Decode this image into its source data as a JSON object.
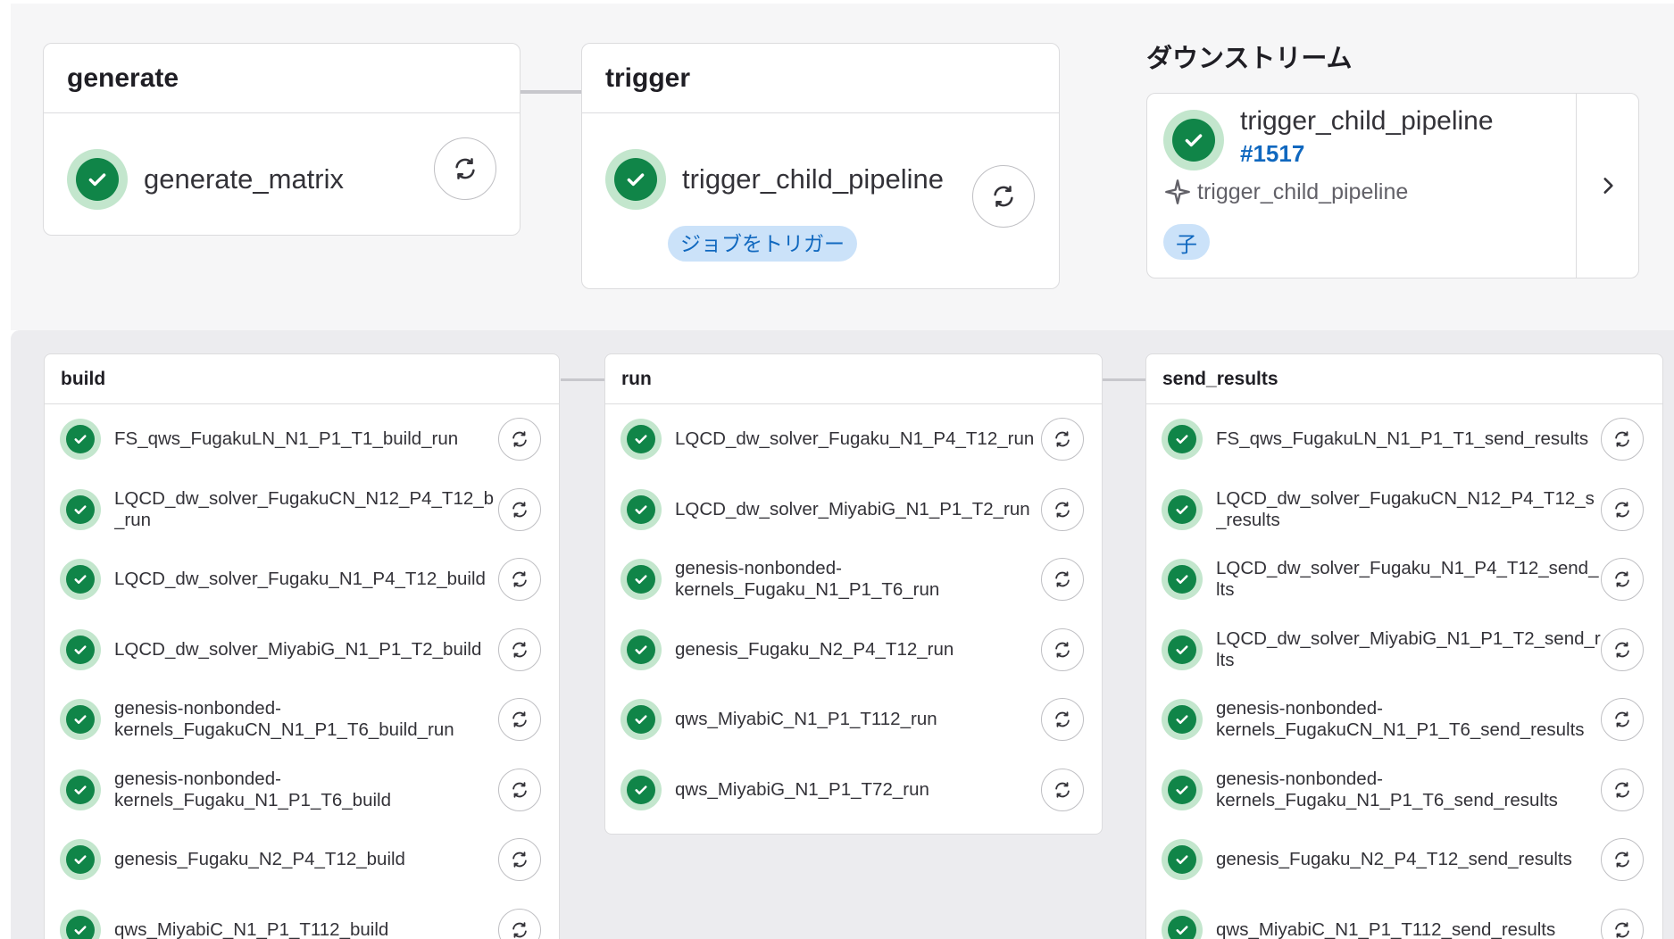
{
  "parent_pipeline": {
    "stages": [
      {
        "name": "generate",
        "job": {
          "name": "generate_matrix",
          "status": "success"
        }
      },
      {
        "name": "trigger",
        "job": {
          "name": "trigger_child_pipeline",
          "status": "success",
          "badge": "ジョブをトリガー"
        }
      }
    ],
    "downstream": {
      "title": "ダウンストリーム",
      "pipeline_name": "trigger_child_pipeline",
      "pipeline_id": "#1517",
      "source_job": "trigger_child_pipeline",
      "relation_badge": "子",
      "status": "success"
    }
  },
  "child_pipeline": {
    "stages": [
      {
        "name": "build",
        "jobs": [
          "FS_qws_FugakuLN_N1_P1_T1_build_run",
          "LQCD_dw_solver_FugakuCN_N12_P4_T12_b\n_run",
          "LQCD_dw_solver_Fugaku_N1_P4_T12_build",
          "LQCD_dw_solver_MiyabiG_N1_P1_T2_build",
          "genesis-nonbonded-\nkernels_FugakuCN_N1_P1_T6_build_run",
          "genesis-nonbonded-\nkernels_Fugaku_N1_P1_T6_build",
          "genesis_Fugaku_N2_P4_T12_build",
          "qws_MiyabiC_N1_P1_T112_build"
        ]
      },
      {
        "name": "run",
        "jobs": [
          "LQCD_dw_solver_Fugaku_N1_P4_T12_run",
          "LQCD_dw_solver_MiyabiG_N1_P1_T2_run",
          "genesis-nonbonded-\nkernels_Fugaku_N1_P1_T6_run",
          "genesis_Fugaku_N2_P4_T12_run",
          "qws_MiyabiC_N1_P1_T112_run",
          "qws_MiyabiG_N1_P1_T72_run"
        ]
      },
      {
        "name": "send_results",
        "jobs": [
          "FS_qws_FugakuLN_N1_P1_T1_send_results",
          "LQCD_dw_solver_FugakuCN_N12_P4_T12_s\n_results",
          "LQCD_dw_solver_Fugaku_N1_P4_T12_send_\nlts",
          "LQCD_dw_solver_MiyabiG_N1_P1_T2_send_r\nlts",
          "genesis-nonbonded-\nkernels_FugakuCN_N1_P1_T6_send_results",
          "genesis-nonbonded-\nkernels_Fugaku_N1_P1_T6_send_results",
          "genesis_Fugaku_N2_P4_T12_send_results",
          "qws_MiyabiC_N1_P1_T112_send_results"
        ]
      }
    ]
  },
  "icons": {
    "status": "check-circle-icon",
    "retry": "retry-icon",
    "expand": "chevron-right-icon",
    "source": "trigger-source-icon"
  },
  "colors": {
    "success": "#108548",
    "success_ring": "#c3e6cd",
    "link": "#1068bf",
    "badge_bg": "#cbe2f9"
  }
}
